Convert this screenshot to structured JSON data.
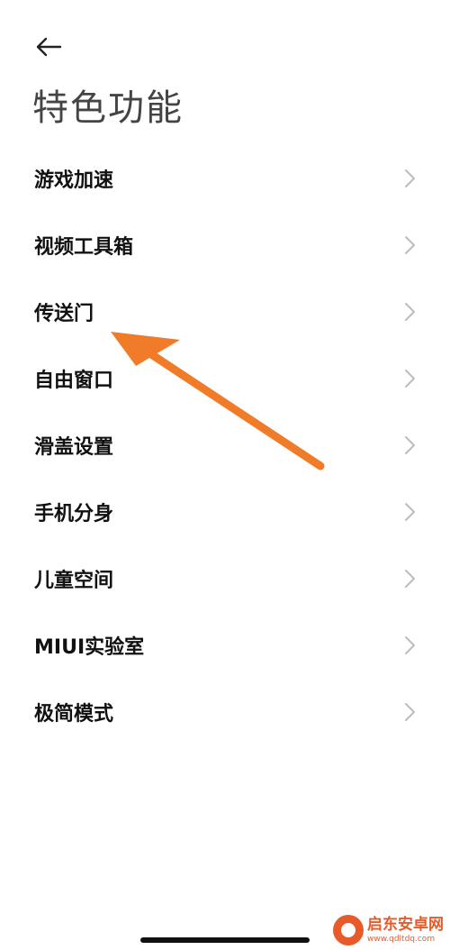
{
  "header": {
    "back_icon": "arrow-left-icon",
    "title": "特色功能"
  },
  "menu": {
    "items": [
      {
        "label": "游戏加速",
        "icon": "chevron-right-icon"
      },
      {
        "label": "视频工具箱",
        "icon": "chevron-right-icon"
      },
      {
        "label": "传送门",
        "icon": "chevron-right-icon"
      },
      {
        "label": "自由窗口",
        "icon": "chevron-right-icon"
      },
      {
        "label": "滑盖设置",
        "icon": "chevron-right-icon"
      },
      {
        "label": "手机分身",
        "icon": "chevron-right-icon"
      },
      {
        "label": "儿童空间",
        "icon": "chevron-right-icon"
      },
      {
        "label": "MIUI实验室",
        "icon": "chevron-right-icon"
      },
      {
        "label": "极简模式",
        "icon": "chevron-right-icon"
      }
    ]
  },
  "annotation": {
    "type": "arrow",
    "color": "#f07c2a",
    "points_to": "传送门"
  },
  "watermark": {
    "name": "启东安卓网",
    "url": "www.qdltdq.com",
    "color": "#e85a2a"
  }
}
